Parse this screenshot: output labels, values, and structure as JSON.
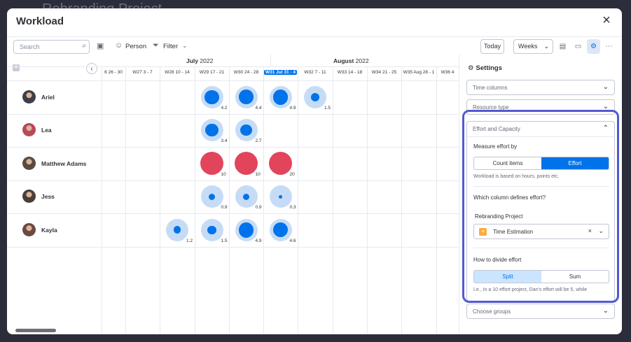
{
  "window": {
    "title": "Workload",
    "backdrop_title": "Rebranding Project"
  },
  "toolbar": {
    "search_placeholder": "Search",
    "person_label": "Person",
    "filter_label": "Filter",
    "today_label": "Today",
    "weeks_label": "Weeks"
  },
  "timeline": {
    "months": [
      {
        "name": "July",
        "year": "2022"
      },
      {
        "name": "August",
        "year": "2022"
      }
    ],
    "weeks": [
      {
        "label": "6  26 - 30"
      },
      {
        "label": "W27  3 - 7"
      },
      {
        "label": "W28  10 - 14"
      },
      {
        "label": "W29  17 - 21"
      },
      {
        "label": "W30  24 - 28"
      },
      {
        "label": "W31  Jul 31 - 4",
        "current": true
      },
      {
        "label": "W32  7 - 11"
      },
      {
        "label": "W33  14 - 18"
      },
      {
        "label": "W34  21 - 25"
      },
      {
        "label": "W35  Aug 28 - 1"
      },
      {
        "label": "W36  4"
      }
    ]
  },
  "people": [
    {
      "name": "Ariel",
      "workload": [
        {
          "week": 3,
          "value": 4.2,
          "load": 0.85
        },
        {
          "week": 4,
          "value": 4.4,
          "load": 0.88
        },
        {
          "week": 5,
          "value": 4.9,
          "load": 0.98
        },
        {
          "week": 6,
          "value": 1.5,
          "load": 0.3
        }
      ]
    },
    {
      "name": "Lea",
      "workload": [
        {
          "week": 3,
          "value": 3.4,
          "load": 0.68
        },
        {
          "week": 4,
          "value": 2.7,
          "load": 0.54
        }
      ]
    },
    {
      "name": "Matthew Adams",
      "workload": [
        {
          "week": 3,
          "value": 10,
          "load": 2.0,
          "over": true
        },
        {
          "week": 4,
          "value": 10,
          "load": 2.0,
          "over": true
        },
        {
          "week": 5,
          "value": 20,
          "load": 4.0,
          "over": true
        }
      ]
    },
    {
      "name": "Jess",
      "workload": [
        {
          "week": 3,
          "value": 0.9,
          "load": 0.18
        },
        {
          "week": 4,
          "value": 0.9,
          "load": 0.18
        },
        {
          "week": 5,
          "value": 0.3,
          "load": 0.06
        }
      ]
    },
    {
      "name": "Kayla",
      "workload": [
        {
          "week": 2,
          "value": 1.2,
          "load": 0.24
        },
        {
          "week": 3,
          "value": 1.5,
          "load": 0.3
        },
        {
          "week": 4,
          "value": 4.9,
          "load": 0.98
        },
        {
          "week": 5,
          "value": 4.6,
          "load": 0.92
        }
      ]
    }
  ],
  "settings": {
    "title": "Settings",
    "time_columns": "Time columns",
    "resource_type": "Resource type",
    "effort_capacity": "Effort and Capacity",
    "measure_label": "Measure effort by",
    "count_items": "Count items",
    "effort": "Effort",
    "effort_hint": "Workload is based on hours, points etc.",
    "which_column": "Which column defines effort?",
    "board_name": "Rebranding Project",
    "column_name": "Time Estimation",
    "divide_label": "How to divide effort",
    "split": "Split",
    "sum": "Sum",
    "divide_hint": "I.e., In a 10 effort project, Dan's effort will be 5, while",
    "choose_groups": "Choose groups"
  },
  "colors": {
    "accent": "#0073ea",
    "over_capacity": "#e2445c",
    "bubble_bg": "#c6dcf6",
    "focus_border": "#5359d1"
  }
}
